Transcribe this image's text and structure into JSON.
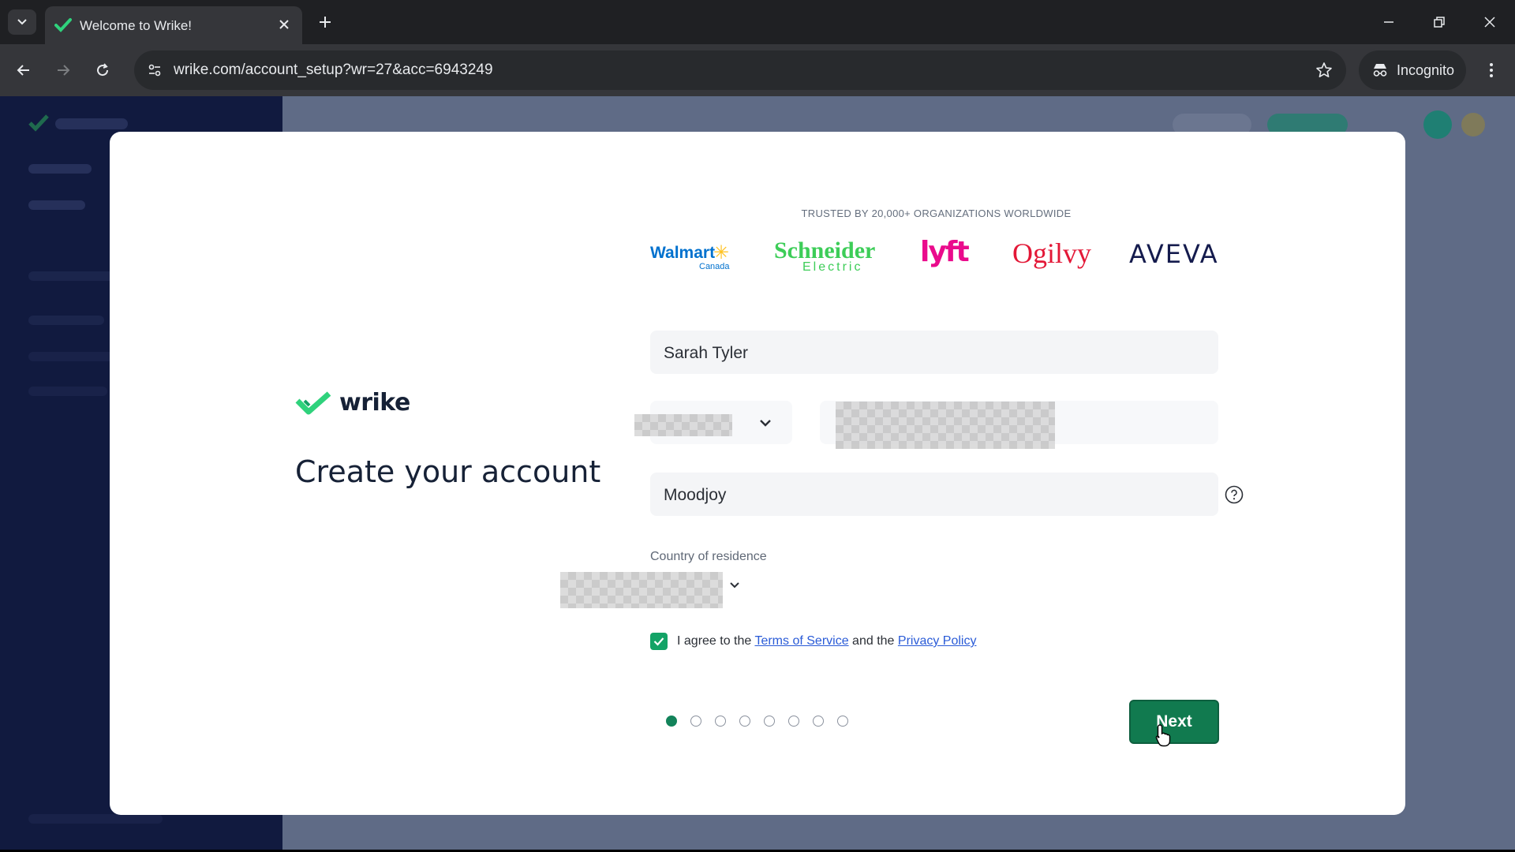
{
  "browser": {
    "tab_title": "Welcome to Wrike!",
    "url": "wrike.com/account_setup?wr=27&acc=6943249",
    "incognito_label": "Incognito"
  },
  "modal": {
    "logo_text": "wrike",
    "headline": "Create your account",
    "trusted_text": "TRUSTED BY 20,000+ ORGANIZATIONS WORLDWIDE",
    "brands": {
      "walmart": "Walmart",
      "walmart_sub": "Canada",
      "schneider": "Schneider",
      "schneider_sub": "Electric",
      "lyft": "lyft",
      "ogilvy": "Ogilvy",
      "aveva": "AVEVA"
    },
    "fields": {
      "full_name": "Sarah Tyler",
      "company": "Moodjoy"
    },
    "country_label": "Country of residence",
    "agree": {
      "prefix": "I agree to the",
      "terms": "Terms of Service",
      "middle": "and the",
      "privacy": "Privacy Policy",
      "checked": true
    },
    "steps": {
      "total": 8,
      "current": 1
    },
    "next_label": "Next"
  },
  "colors": {
    "accent": "#117a4f",
    "check": "#13a366",
    "link": "#2a5bd7"
  }
}
